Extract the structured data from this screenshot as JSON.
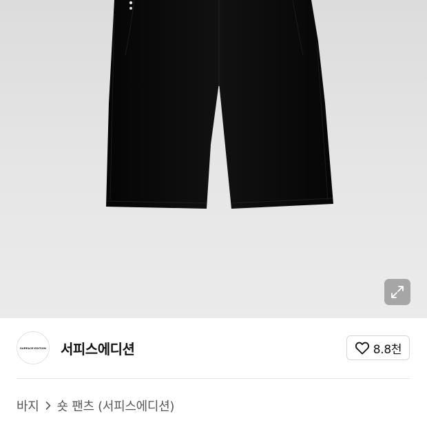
{
  "product_image": {
    "alt": "black shorts",
    "background_color": "#e4e4e4",
    "expand_icon": "expand-arrows-icon"
  },
  "brand": {
    "logo_text": "SURFACE EDITION",
    "name": "서피스에디션"
  },
  "like": {
    "icon": "heart-outline-icon",
    "count": "8.8천"
  },
  "breadcrumb": {
    "items": [
      "바지",
      "숏 팬츠 (서피스에디션)"
    ],
    "separator_icon": "chevron-right-icon"
  }
}
